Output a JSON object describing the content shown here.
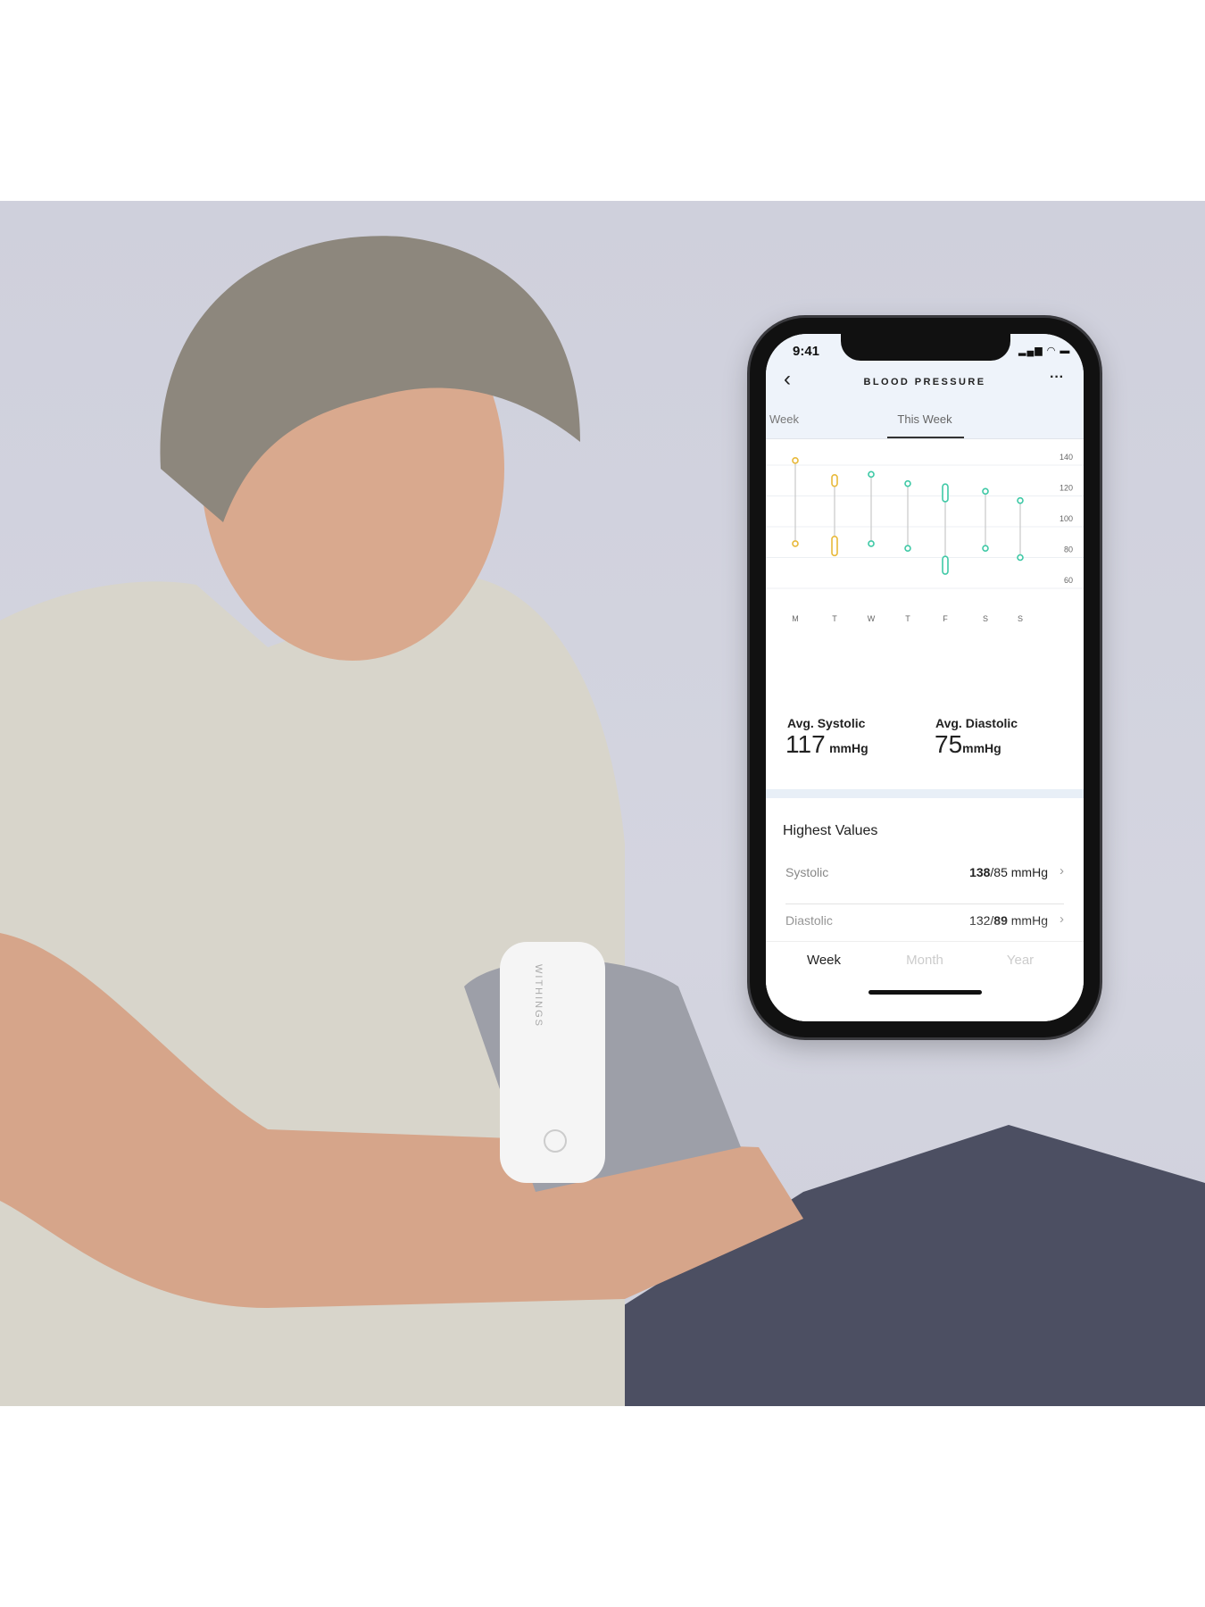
{
  "status_bar": {
    "time": "9:41"
  },
  "header": {
    "title": "BLOOD PRESSURE",
    "back_icon": "chevron-left-icon",
    "more_icon": "ellipsis-icon"
  },
  "period_tabs": {
    "previous": "Week",
    "current": "This Week"
  },
  "chart_data": {
    "type": "range",
    "categories": [
      "M",
      "T",
      "W",
      "T",
      "F",
      "S",
      "S"
    ],
    "y_ticks": [
      "140",
      "120",
      "100",
      "80",
      "60"
    ],
    "ylim": [
      60,
      140
    ],
    "grid": true,
    "series": [
      {
        "systolic": [
          143,
          143
        ],
        "diastolic": [
          89,
          89
        ],
        "color": "#e8b93a"
      },
      {
        "systolic": [
          128,
          132
        ],
        "diastolic": [
          83,
          92
        ],
        "color": "#e8b93a"
      },
      {
        "systolic": [
          134,
          134
        ],
        "diastolic": [
          89,
          89
        ],
        "color": "#3fc9a6"
      },
      {
        "systolic": [
          128,
          128
        ],
        "diastolic": [
          86,
          86
        ],
        "color": "#3fc9a6"
      },
      {
        "systolic": [
          118,
          126
        ],
        "diastolic": [
          71,
          79
        ],
        "color": "#3fc9a6"
      },
      {
        "systolic": [
          123,
          123
        ],
        "diastolic": [
          86,
          86
        ],
        "color": "#3fc9a6"
      },
      {
        "systolic": [
          117,
          117
        ],
        "diastolic": [
          80,
          80
        ],
        "color": "#3fc9a6"
      }
    ]
  },
  "averages": {
    "systolic": {
      "label": "Avg. Systolic",
      "value": "117",
      "unit": "mmHg"
    },
    "diastolic": {
      "label": "Avg. Diastolic",
      "value": "75",
      "unit": "mmHg"
    }
  },
  "highest": {
    "title": "Highest Values",
    "rows": [
      {
        "label": "Systolic",
        "bold": "138",
        "rest": "/85 mmHg",
        "pre": ""
      },
      {
        "label": "Diastolic",
        "pre": "132/",
        "bold": "89",
        "rest": " mmHg"
      }
    ]
  },
  "bottom_tabs": [
    "Week",
    "Month",
    "Year"
  ],
  "device_brand": "WITHINGS"
}
